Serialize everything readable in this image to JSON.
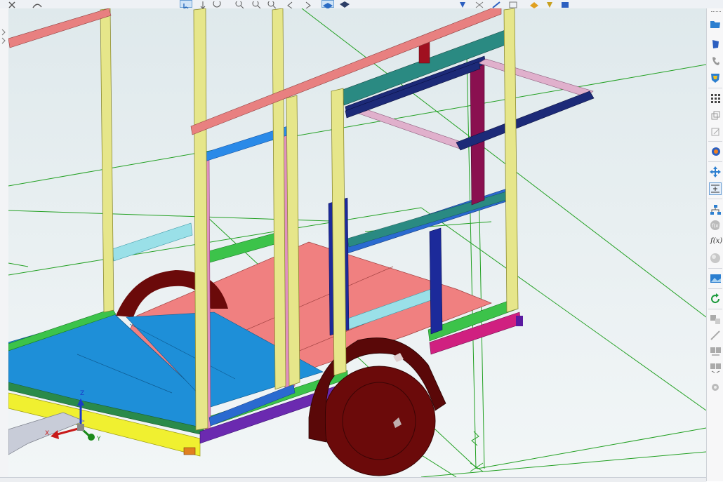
{
  "window": {
    "kind": "3D CAD modeling view"
  },
  "colors": {
    "viewport_bg": "#e3ecee",
    "construction_line": "#22a022",
    "upright": "#e6e68a",
    "top_rail": "#e88080",
    "floor_blue": "#1e8fd8",
    "floor_red": "#f08080",
    "wheel": "#6b0a0a",
    "dark_blue_rail": "#1c2a78",
    "teal_rail": "#2a8a82",
    "pink_rail": "#e0b0cc",
    "green_frame": "#3cc34a",
    "yellow_chassis": "#f0f030"
  },
  "top_toolbar": {
    "icons": [
      "close-icon",
      "redo-icon",
      "select-icon",
      "zoom-icon",
      "zoom-in-icon",
      "zoom-out-icon",
      "arrow-left-icon",
      "arrow-right-icon",
      "view-shaded-icon",
      "view-cube-icon",
      "pin-icon",
      "tools-icon",
      "measure-icon",
      "copy-icon",
      "lock-icon",
      "layers-icon"
    ]
  },
  "right_toolbar": {
    "items": [
      {
        "name": "open-folder-icon"
      },
      {
        "name": "blue-shield-icon"
      },
      {
        "name": "phone-icon"
      },
      {
        "name": "shield-badge-icon"
      },
      {
        "name": "grid-icon"
      },
      {
        "name": "duplicate-icon"
      },
      {
        "name": "edit-icon"
      },
      {
        "name": "paint-icon"
      },
      {
        "name": "move-icon"
      },
      {
        "name": "align-icon"
      },
      {
        "name": "hierarchy-icon"
      },
      {
        "name": "function-circle-icon"
      },
      {
        "name": "function-icon",
        "label": "f(x)"
      },
      {
        "name": "sphere-icon"
      },
      {
        "name": "image-icon"
      },
      {
        "name": "refresh-icon"
      },
      {
        "name": "part-icon"
      },
      {
        "name": "wand-icon"
      },
      {
        "name": "split-icon"
      },
      {
        "name": "merge-icon"
      },
      {
        "name": "gear-icon"
      }
    ]
  },
  "axis_triad": {
    "x_label": "X",
    "y_label": "Y",
    "z_label": "Z"
  }
}
